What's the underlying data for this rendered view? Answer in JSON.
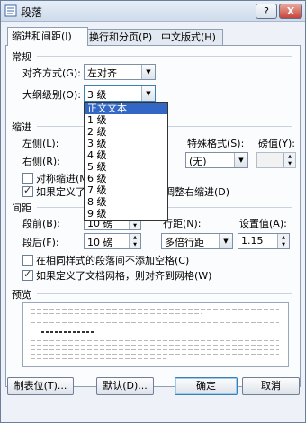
{
  "window": {
    "title": "段落",
    "help_label": "?",
    "close_label": "X"
  },
  "tabs": [
    {
      "label": "缩进和间距(I)"
    },
    {
      "label": "换行和分页(P)"
    },
    {
      "label": "中文版式(H)"
    }
  ],
  "general": {
    "heading": "常规",
    "alignment_label": "对齐方式(G):",
    "alignment_value": "左对齐",
    "outline_label": "大纲级别(O):",
    "outline_value": "3 级"
  },
  "outline_dropdown": {
    "options": [
      "正文文本",
      "1 级",
      "2 级",
      "3 级",
      "4 级",
      "5 级",
      "6 级",
      "7 级",
      "8 级",
      "9 级"
    ],
    "selected": "正文文本"
  },
  "indent": {
    "heading": "缩进",
    "left_label": "左侧(L):",
    "right_label": "右侧(R):",
    "special_label": "特殊格式(S):",
    "special_value": "(无)",
    "degree_label": "磅值(Y):",
    "mirror_label": "对称缩进(M)",
    "grid_label": "如果定义了文档网格，则自动调整右缩进(D)"
  },
  "spacing": {
    "heading": "间距",
    "before_label": "段前(B):",
    "before_value": "10 磅",
    "after_label": "段后(F):",
    "after_value": "10 磅",
    "line_label": "行距(N):",
    "line_value": "多倍行距",
    "at_label": "设置值(A):",
    "at_value": "1.15",
    "no_space_label": "在相同样式的段落间不添加空格(C)",
    "snap_grid_label": "如果定义了文档网格，则对齐到网格(W)"
  },
  "preview": {
    "heading": "预览"
  },
  "buttons": {
    "tabs_label": "制表位(T)...",
    "default_label": "默认(D)...",
    "ok_label": "确定",
    "cancel_label": "取消"
  },
  "colors": {
    "selection": "#3367c5",
    "title_bar": "#cfdbeb",
    "close_button": "#c8453a"
  }
}
